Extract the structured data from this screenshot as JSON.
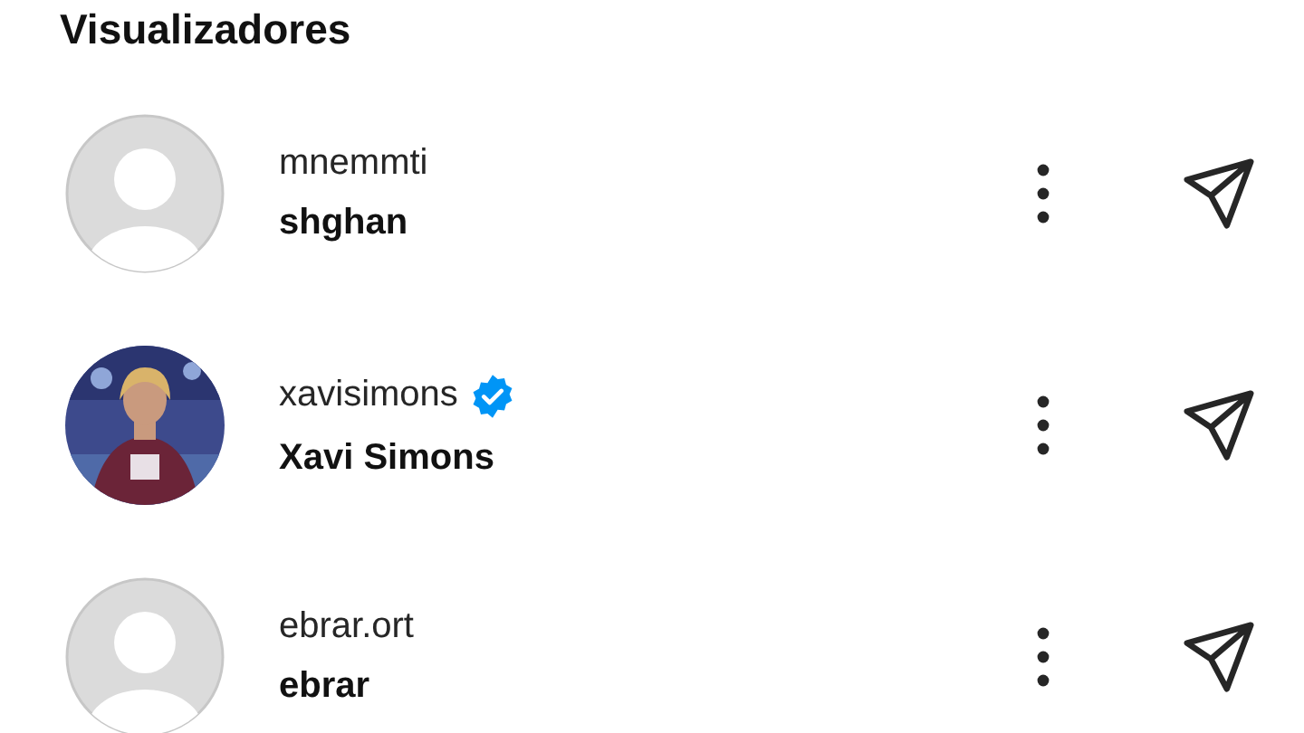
{
  "title": "Visualizadores",
  "viewers": [
    {
      "username": "mnemmti",
      "name": "shghan",
      "verified": false,
      "avatar": {
        "kind": "default"
      }
    },
    {
      "username": "xavisimons",
      "name": "Xavi Simons",
      "verified": true
    },
    {
      "username": "ebrar.ort",
      "name": "ebrar",
      "verified": false,
      "avatar": {
        "kind": "default"
      }
    }
  ]
}
